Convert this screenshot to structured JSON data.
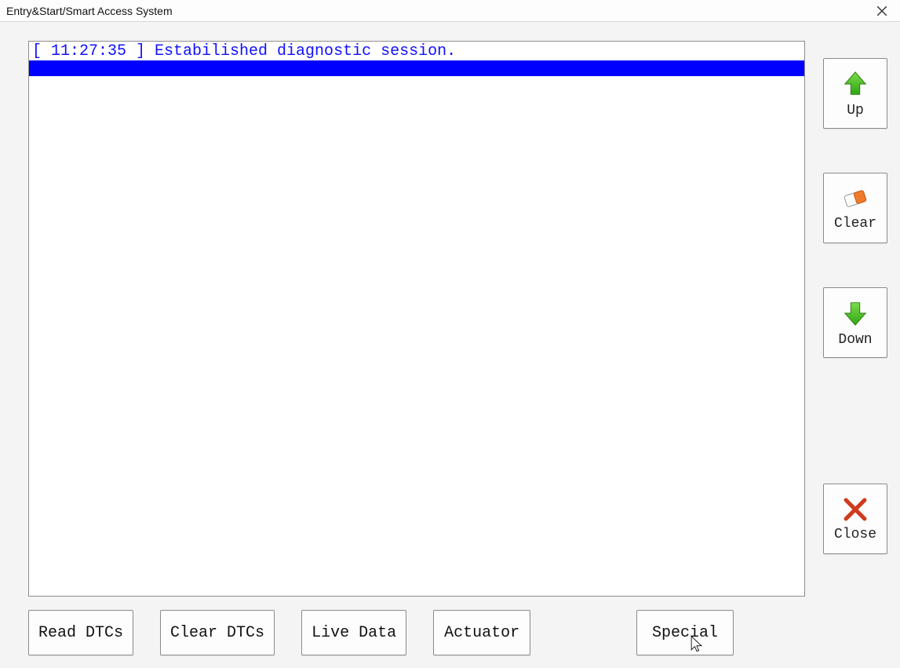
{
  "window": {
    "title": "Entry&Start/Smart Access System"
  },
  "console": {
    "lines": [
      "[ 11:27:35 ] Estabilished diagnostic session."
    ]
  },
  "side_buttons": {
    "up": {
      "label": "Up"
    },
    "clear": {
      "label": "Clear"
    },
    "down": {
      "label": "Down"
    },
    "close": {
      "label": "Close"
    }
  },
  "bottom_buttons": {
    "read_dtcs": {
      "label": "Read DTCs"
    },
    "clear_dtcs": {
      "label": "Clear DTCs"
    },
    "live_data": {
      "label": "Live Data"
    },
    "actuator": {
      "label": "Actuator"
    },
    "special": {
      "label": "Special"
    }
  }
}
